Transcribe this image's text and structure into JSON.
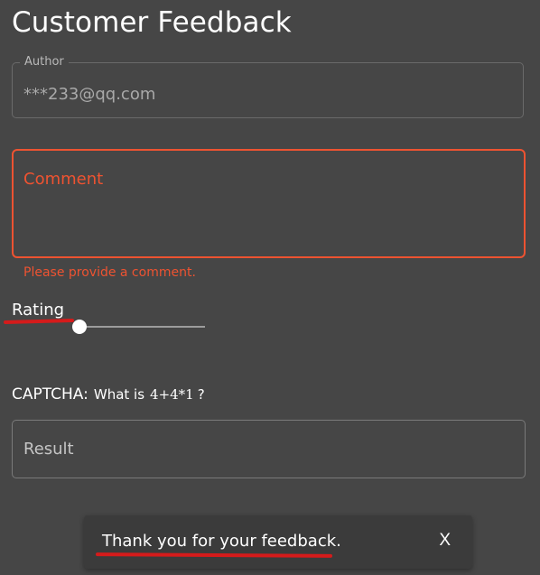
{
  "page": {
    "title": "Customer Feedback"
  },
  "form": {
    "author": {
      "label": "Author",
      "value": "***233@qq.com"
    },
    "comment": {
      "placeholder": "Comment",
      "error": "Please provide a comment."
    },
    "rating": {
      "label": "Rating",
      "value_fraction": 0.0
    },
    "captcha": {
      "label": "CAPTCHA:",
      "question": "What is",
      "expression": "4+4*1",
      "question_mark": "?"
    },
    "result": {
      "placeholder": "Result"
    }
  },
  "snackbar": {
    "message": "Thank you for your feedback.",
    "close_label": "X"
  },
  "colors": {
    "background": "#464646",
    "error": "#ee5331",
    "annotation_red": "#d51b1b",
    "snackbar_bg": "#3b3b3b"
  },
  "icons": {
    "slider_thumb": "circle"
  }
}
